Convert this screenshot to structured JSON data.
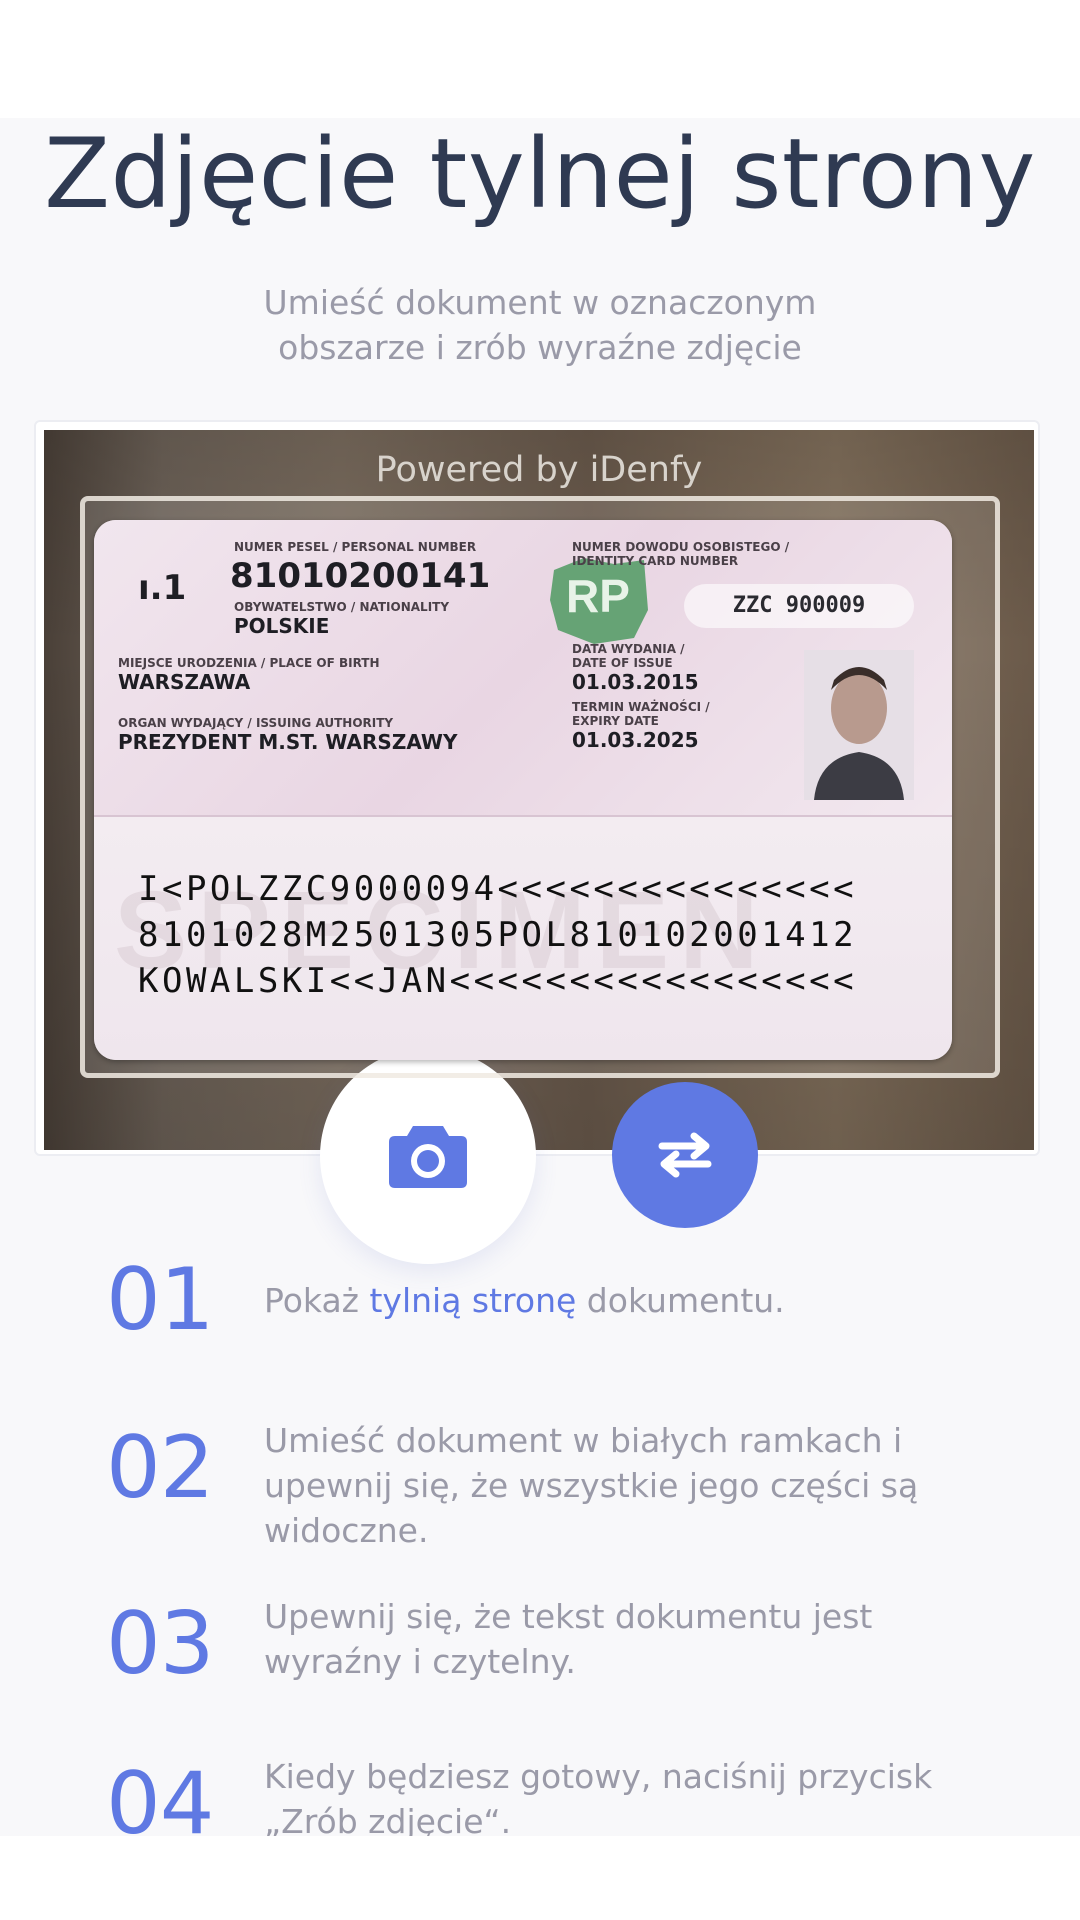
{
  "page": {
    "title": "Zdjęcie tylnej strony",
    "subtitle_line1": "Umieść dokument w oznaczonym",
    "subtitle_line2": "obszarze i zrób wyraźne zdjęcie"
  },
  "camera": {
    "powered_by": "Powered by iDenfy",
    "card": {
      "pesel_label": "NUMER PESEL / PERSONAL NUMBER",
      "pesel_value": "81010200141",
      "nationality_label": "OBYWATELSTWO / NATIONALITY",
      "nationality_value": "POLSKIE",
      "birthplace_label": "MIEJSCE URODZENIA / PLACE OF BIRTH",
      "birthplace_value": "WARSZAWA",
      "authority_label": "ORGAN WYDAJĄCY / ISSUING AUTHORITY",
      "authority_value": "PREZYDENT M.ST. WARSZAWY",
      "idno_label_1": "NUMER DOWODU OSOBISTEGO /",
      "idno_label_2": "IDENTITY CARD NUMBER",
      "idno_value": "ZZC 900009",
      "issue_label_1": "DATA WYDANIA /",
      "issue_label_2": "DATE OF ISSUE",
      "issue_value": "01.03.2015",
      "expiry_label_1": "TERMIN WAŻNOŚCI /",
      "expiry_label_2": "EXPIRY DATE",
      "expiry_value": "01.03.2025",
      "rp_logo": "RP",
      "corner_mark": "ı.1",
      "mrz_line1": "I<POLZZC9000094<<<<<<<<<<<<<<<",
      "mrz_line2": "8101028M2501305POL810102001412",
      "mrz_line3": "KOWALSKI<<JAN<<<<<<<<<<<<<<<<<"
    },
    "shutter_icon": "camera-icon",
    "switch_icon": "swap-arrows-icon",
    "accent_color": "#5f79e3"
  },
  "steps": [
    {
      "number": "01",
      "text_before": "Pokaż ",
      "highlight": "tylnią stronę",
      "text_after": " dokumentu."
    },
    {
      "number": "02",
      "text": "Umieść dokument w białych ramkach i upewnij się, że wszystkie jego części są widoczne."
    },
    {
      "number": "03",
      "text": "Upewnij się, że tekst dokumentu jest wyraźny i czytelny."
    },
    {
      "number": "04",
      "text": "Kiedy będziesz gotowy, naciśnij przycisk „Zrób zdjęcie“."
    }
  ]
}
